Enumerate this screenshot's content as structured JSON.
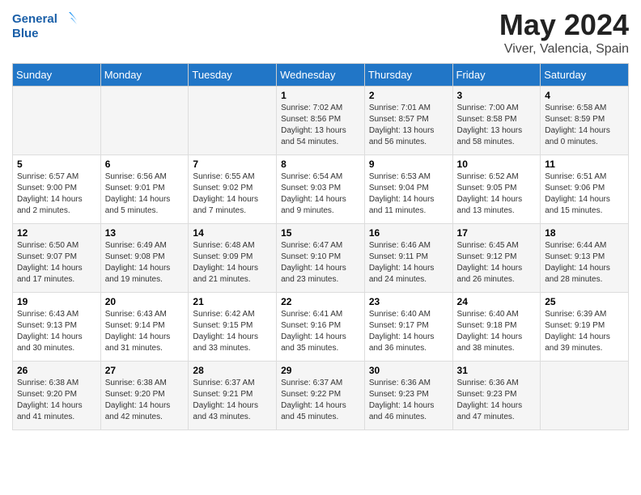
{
  "header": {
    "logo_general": "General",
    "logo_blue": "Blue",
    "main_title": "May 2024",
    "subtitle": "Viver, Valencia, Spain"
  },
  "calendar": {
    "weekdays": [
      "Sunday",
      "Monday",
      "Tuesday",
      "Wednesday",
      "Thursday",
      "Friday",
      "Saturday"
    ],
    "weeks": [
      [
        {
          "day": "",
          "info": ""
        },
        {
          "day": "",
          "info": ""
        },
        {
          "day": "",
          "info": ""
        },
        {
          "day": "1",
          "info": "Sunrise: 7:02 AM\nSunset: 8:56 PM\nDaylight: 13 hours\nand 54 minutes."
        },
        {
          "day": "2",
          "info": "Sunrise: 7:01 AM\nSunset: 8:57 PM\nDaylight: 13 hours\nand 56 minutes."
        },
        {
          "day": "3",
          "info": "Sunrise: 7:00 AM\nSunset: 8:58 PM\nDaylight: 13 hours\nand 58 minutes."
        },
        {
          "day": "4",
          "info": "Sunrise: 6:58 AM\nSunset: 8:59 PM\nDaylight: 14 hours\nand 0 minutes."
        }
      ],
      [
        {
          "day": "5",
          "info": "Sunrise: 6:57 AM\nSunset: 9:00 PM\nDaylight: 14 hours\nand 2 minutes."
        },
        {
          "day": "6",
          "info": "Sunrise: 6:56 AM\nSunset: 9:01 PM\nDaylight: 14 hours\nand 5 minutes."
        },
        {
          "day": "7",
          "info": "Sunrise: 6:55 AM\nSunset: 9:02 PM\nDaylight: 14 hours\nand 7 minutes."
        },
        {
          "day": "8",
          "info": "Sunrise: 6:54 AM\nSunset: 9:03 PM\nDaylight: 14 hours\nand 9 minutes."
        },
        {
          "day": "9",
          "info": "Sunrise: 6:53 AM\nSunset: 9:04 PM\nDaylight: 14 hours\nand 11 minutes."
        },
        {
          "day": "10",
          "info": "Sunrise: 6:52 AM\nSunset: 9:05 PM\nDaylight: 14 hours\nand 13 minutes."
        },
        {
          "day": "11",
          "info": "Sunrise: 6:51 AM\nSunset: 9:06 PM\nDaylight: 14 hours\nand 15 minutes."
        }
      ],
      [
        {
          "day": "12",
          "info": "Sunrise: 6:50 AM\nSunset: 9:07 PM\nDaylight: 14 hours\nand 17 minutes."
        },
        {
          "day": "13",
          "info": "Sunrise: 6:49 AM\nSunset: 9:08 PM\nDaylight: 14 hours\nand 19 minutes."
        },
        {
          "day": "14",
          "info": "Sunrise: 6:48 AM\nSunset: 9:09 PM\nDaylight: 14 hours\nand 21 minutes."
        },
        {
          "day": "15",
          "info": "Sunrise: 6:47 AM\nSunset: 9:10 PM\nDaylight: 14 hours\nand 23 minutes."
        },
        {
          "day": "16",
          "info": "Sunrise: 6:46 AM\nSunset: 9:11 PM\nDaylight: 14 hours\nand 24 minutes."
        },
        {
          "day": "17",
          "info": "Sunrise: 6:45 AM\nSunset: 9:12 PM\nDaylight: 14 hours\nand 26 minutes."
        },
        {
          "day": "18",
          "info": "Sunrise: 6:44 AM\nSunset: 9:13 PM\nDaylight: 14 hours\nand 28 minutes."
        }
      ],
      [
        {
          "day": "19",
          "info": "Sunrise: 6:43 AM\nSunset: 9:13 PM\nDaylight: 14 hours\nand 30 minutes."
        },
        {
          "day": "20",
          "info": "Sunrise: 6:43 AM\nSunset: 9:14 PM\nDaylight: 14 hours\nand 31 minutes."
        },
        {
          "day": "21",
          "info": "Sunrise: 6:42 AM\nSunset: 9:15 PM\nDaylight: 14 hours\nand 33 minutes."
        },
        {
          "day": "22",
          "info": "Sunrise: 6:41 AM\nSunset: 9:16 PM\nDaylight: 14 hours\nand 35 minutes."
        },
        {
          "day": "23",
          "info": "Sunrise: 6:40 AM\nSunset: 9:17 PM\nDaylight: 14 hours\nand 36 minutes."
        },
        {
          "day": "24",
          "info": "Sunrise: 6:40 AM\nSunset: 9:18 PM\nDaylight: 14 hours\nand 38 minutes."
        },
        {
          "day": "25",
          "info": "Sunrise: 6:39 AM\nSunset: 9:19 PM\nDaylight: 14 hours\nand 39 minutes."
        }
      ],
      [
        {
          "day": "26",
          "info": "Sunrise: 6:38 AM\nSunset: 9:20 PM\nDaylight: 14 hours\nand 41 minutes."
        },
        {
          "day": "27",
          "info": "Sunrise: 6:38 AM\nSunset: 9:20 PM\nDaylight: 14 hours\nand 42 minutes."
        },
        {
          "day": "28",
          "info": "Sunrise: 6:37 AM\nSunset: 9:21 PM\nDaylight: 14 hours\nand 43 minutes."
        },
        {
          "day": "29",
          "info": "Sunrise: 6:37 AM\nSunset: 9:22 PM\nDaylight: 14 hours\nand 45 minutes."
        },
        {
          "day": "30",
          "info": "Sunrise: 6:36 AM\nSunset: 9:23 PM\nDaylight: 14 hours\nand 46 minutes."
        },
        {
          "day": "31",
          "info": "Sunrise: 6:36 AM\nSunset: 9:23 PM\nDaylight: 14 hours\nand 47 minutes."
        },
        {
          "day": "",
          "info": ""
        }
      ]
    ]
  }
}
